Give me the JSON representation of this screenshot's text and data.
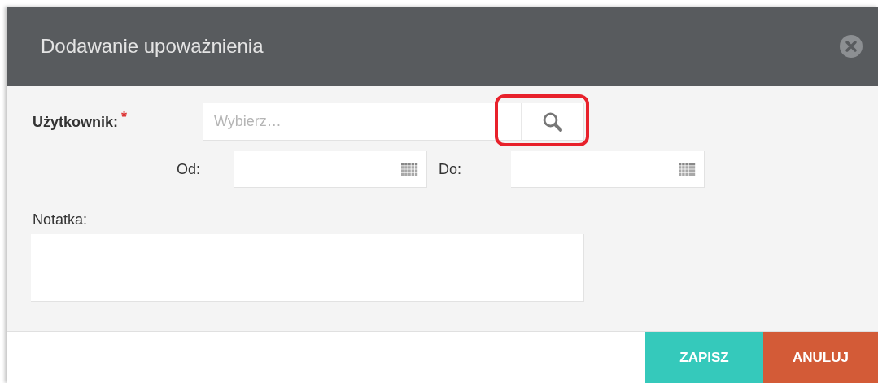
{
  "dialog": {
    "title": "Dodawanie upoważnienia"
  },
  "user_field": {
    "label": "Użytkownik:",
    "required_mark": "*",
    "placeholder": "Wybierz…"
  },
  "date_from": {
    "label": "Od:"
  },
  "date_to": {
    "label": "Do:"
  },
  "note": {
    "label": "Notatka:"
  },
  "buttons": [
    {
      "label": "ZAPISZ",
      "kind": "primary"
    },
    {
      "label": "ANULUJ",
      "kind": "cancel"
    }
  ]
}
